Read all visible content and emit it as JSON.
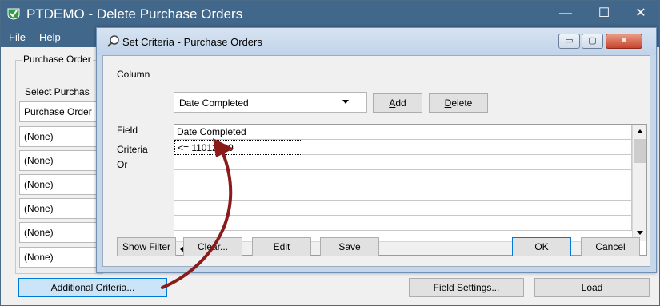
{
  "main_window": {
    "title": "PTDEMO - Delete Purchase Orders",
    "controls": {
      "minimize": "—",
      "maximize": "☐",
      "close": "✕"
    },
    "menu": [
      {
        "accel": "F",
        "rest": "ile"
      },
      {
        "accel": "H",
        "rest": "elp"
      }
    ],
    "group_title": "Purchase Order",
    "select_label": "Select Purchas",
    "fields": [
      "Purchase Order",
      "(None)",
      "(None)",
      "(None)",
      "(None)",
      "(None)",
      "(None)"
    ],
    "buttons": {
      "additional": "Additional Criteria...",
      "field_settings": "Field Settings...",
      "load": "Load"
    }
  },
  "dialog": {
    "title": "Set Criteria - Purchase Orders",
    "controls": {
      "minimize": "▭",
      "maximize": "▢",
      "close": "✕"
    },
    "column_label": "Column",
    "column_value": "Date Completed",
    "add_accel": "A",
    "add_rest": "dd",
    "delete_accel": "D",
    "delete_rest": "elete",
    "row_labels": {
      "field": "Field",
      "criteria": "Criteria",
      "or": "Or"
    },
    "grid": {
      "header": [
        "Date Completed",
        "",
        "",
        ""
      ],
      "criteria": [
        "<= 11012019",
        "",
        "",
        ""
      ]
    },
    "buttons": {
      "show_filter": "Show Filter",
      "clear": "Clear...",
      "edit": "Edit",
      "save": "Save",
      "ok": "OK",
      "cancel": "Cancel"
    }
  },
  "colors": {
    "titlebar": "#41678b",
    "dialog_frame": "#c7d7ea",
    "annotation_arrow": "#8b1a1a"
  },
  "icons": [
    "shield-check-icon",
    "magnifier-icon",
    "dropdown-arrow-icon",
    "scroll-up-icon",
    "scroll-down-icon",
    "scroll-left-icon",
    "scroll-right-icon"
  ]
}
